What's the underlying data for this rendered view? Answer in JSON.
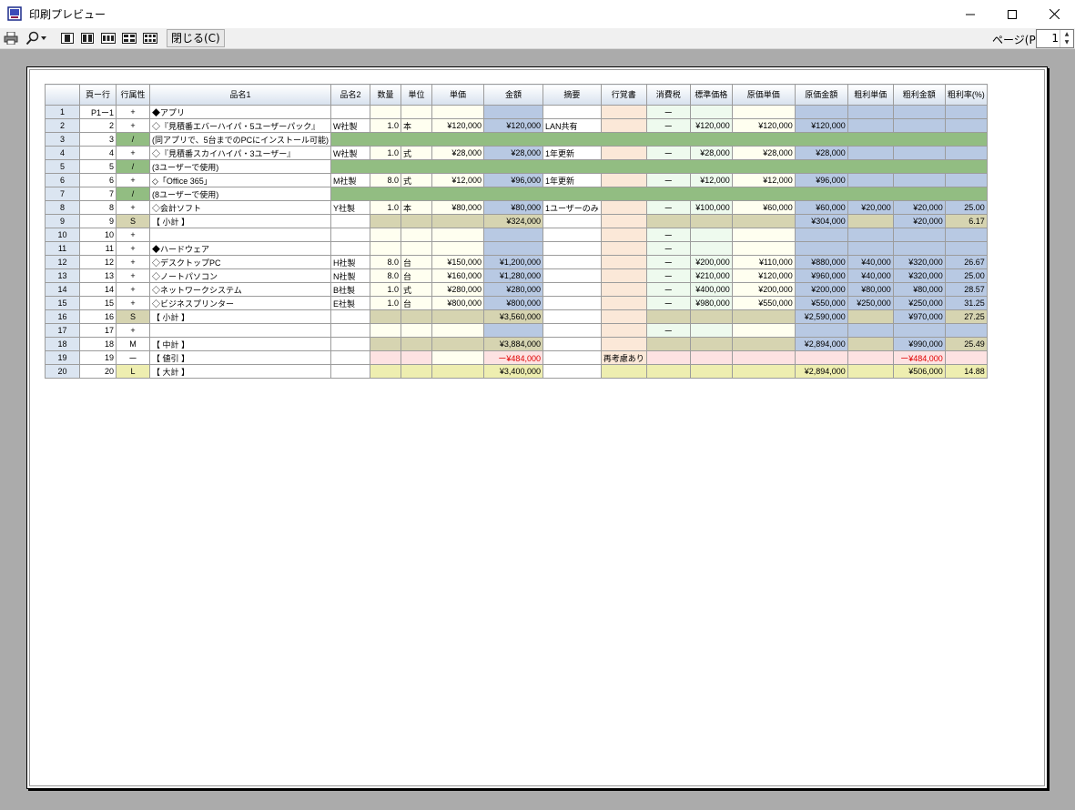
{
  "window": {
    "title": "印刷プレビュー"
  },
  "toolbar": {
    "close_label": "閉じる(C)",
    "page_label": "ページ(P)",
    "page_value": "1"
  },
  "table": {
    "headers": [
      "",
      "頁ー行",
      "行属性",
      "品名1",
      "品名2",
      "数量",
      "単位",
      "単価",
      "金額",
      "摘要",
      "行覚書",
      "消費税",
      "標準価格",
      "原価単価",
      "原価金額",
      "粗利単価",
      "粗利金額",
      "粗利率(%)"
    ],
    "rows": [
      {
        "type": "item",
        "cells": [
          "1",
          "P1ー1",
          "+",
          "◆アプリ",
          "",
          "",
          "",
          "",
          "",
          "",
          "",
          "ー",
          "",
          "",
          "",
          "",
          "",
          ""
        ]
      },
      {
        "type": "item",
        "cells": [
          "2",
          "2",
          "+",
          "◇『見積番エバーハイパ・5ユーザーパック』",
          "W社製",
          "1.0",
          "本",
          "¥120,000",
          "¥120,000",
          "LAN共有",
          "",
          "ー",
          "¥120,000",
          "¥120,000",
          "¥120,000",
          "",
          "",
          ""
        ]
      },
      {
        "type": "note",
        "cells": [
          "3",
          "3",
          "/",
          "(同アプリで、5台までのPCにインストール可能)"
        ]
      },
      {
        "type": "item",
        "cells": [
          "4",
          "4",
          "+",
          "◇『見積番スカイハイパ・3ユーザー』",
          "W社製",
          "1.0",
          "式",
          "¥28,000",
          "¥28,000",
          "1年更新",
          "",
          "ー",
          "¥28,000",
          "¥28,000",
          "¥28,000",
          "",
          "",
          ""
        ]
      },
      {
        "type": "note",
        "cells": [
          "5",
          "5",
          "/",
          "(3ユーザーで使用)"
        ]
      },
      {
        "type": "item",
        "cells": [
          "6",
          "6",
          "+",
          "◇「Office 365」",
          "M社製",
          "8.0",
          "式",
          "¥12,000",
          "¥96,000",
          "1年更新",
          "",
          "ー",
          "¥12,000",
          "¥12,000",
          "¥96,000",
          "",
          "",
          ""
        ]
      },
      {
        "type": "note",
        "cells": [
          "7",
          "7",
          "/",
          "(8ユーザーで使用)"
        ]
      },
      {
        "type": "item",
        "cells": [
          "8",
          "8",
          "+",
          "◇会計ソフト",
          "Y社製",
          "1.0",
          "本",
          "¥80,000",
          "¥80,000",
          "1ユーザーのみ",
          "",
          "ー",
          "¥100,000",
          "¥60,000",
          "¥60,000",
          "¥20,000",
          "¥20,000",
          "25.00"
        ]
      },
      {
        "type": "subtotal",
        "cells": [
          "9",
          "9",
          "S",
          "【 小計 】",
          "",
          "",
          "",
          "",
          "¥324,000",
          "",
          "",
          "",
          "",
          "",
          "¥304,000",
          "",
          "¥20,000",
          "6.17"
        ]
      },
      {
        "type": "item",
        "cells": [
          "10",
          "10",
          "+",
          "",
          "",
          "",
          "",
          "",
          "",
          "",
          "",
          "ー",
          "",
          "",
          "",
          "",
          "",
          ""
        ]
      },
      {
        "type": "item",
        "cells": [
          "11",
          "11",
          "+",
          "◆ハードウェア",
          "",
          "",
          "",
          "",
          "",
          "",
          "",
          "ー",
          "",
          "",
          "",
          "",
          "",
          ""
        ]
      },
      {
        "type": "item",
        "cells": [
          "12",
          "12",
          "+",
          "◇デスクトップPC",
          "H社製",
          "8.0",
          "台",
          "¥150,000",
          "¥1,200,000",
          "",
          "",
          "ー",
          "¥200,000",
          "¥110,000",
          "¥880,000",
          "¥40,000",
          "¥320,000",
          "26.67"
        ]
      },
      {
        "type": "item",
        "cells": [
          "13",
          "13",
          "+",
          "◇ノートパソコン",
          "N社製",
          "8.0",
          "台",
          "¥160,000",
          "¥1,280,000",
          "",
          "",
          "ー",
          "¥210,000",
          "¥120,000",
          "¥960,000",
          "¥40,000",
          "¥320,000",
          "25.00"
        ]
      },
      {
        "type": "item",
        "cells": [
          "14",
          "14",
          "+",
          "◇ネットワークシステム",
          "B社製",
          "1.0",
          "式",
          "¥280,000",
          "¥280,000",
          "",
          "",
          "ー",
          "¥400,000",
          "¥200,000",
          "¥200,000",
          "¥80,000",
          "¥80,000",
          "28.57"
        ]
      },
      {
        "type": "item",
        "cells": [
          "15",
          "15",
          "+",
          "◇ビジネスプリンター",
          "E社製",
          "1.0",
          "台",
          "¥800,000",
          "¥800,000",
          "",
          "",
          "ー",
          "¥980,000",
          "¥550,000",
          "¥550,000",
          "¥250,000",
          "¥250,000",
          "31.25"
        ]
      },
      {
        "type": "subtotal",
        "cells": [
          "16",
          "16",
          "S",
          "【 小計 】",
          "",
          "",
          "",
          "",
          "¥3,560,000",
          "",
          "",
          "",
          "",
          "",
          "¥2,590,000",
          "",
          "¥970,000",
          "27.25"
        ]
      },
      {
        "type": "item",
        "cells": [
          "17",
          "17",
          "+",
          "",
          "",
          "",
          "",
          "",
          "",
          "",
          "",
          "ー",
          "",
          "",
          "",
          "",
          "",
          ""
        ]
      },
      {
        "type": "midtotal",
        "cells": [
          "18",
          "18",
          "M",
          "【 中計 】",
          "",
          "",
          "",
          "",
          "¥3,884,000",
          "",
          "",
          "",
          "",
          "",
          "¥2,894,000",
          "",
          "¥990,000",
          "25.49"
        ]
      },
      {
        "type": "discount",
        "cells": [
          "19",
          "19",
          "ー",
          "【 値引 】",
          "",
          "",
          "",
          "",
          "ー¥484,000",
          "",
          "再考慮あり",
          "",
          "",
          "",
          "",
          "",
          "ー¥484,000",
          ""
        ]
      },
      {
        "type": "total",
        "cells": [
          "20",
          "20",
          "L",
          "【 大計 】",
          "",
          "",
          "",
          "",
          "¥3,400,000",
          "",
          "",
          "",
          "",
          "",
          "¥2,894,000",
          "",
          "¥506,000",
          "14.88"
        ]
      }
    ]
  }
}
